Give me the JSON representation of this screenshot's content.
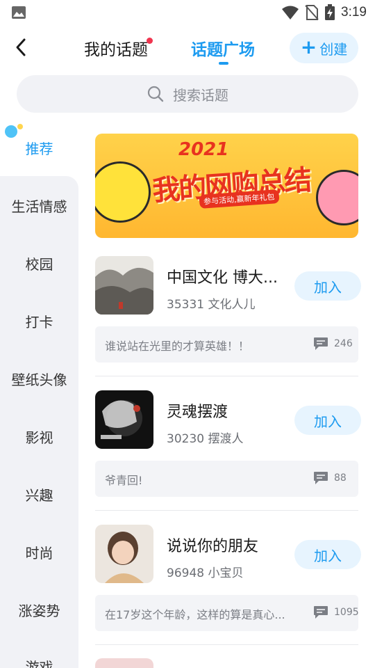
{
  "status_bar": {
    "time": "3:19"
  },
  "header": {
    "tab_mine": "我的话题",
    "tab_plaza": "话题广场",
    "create_label": "创建"
  },
  "search": {
    "placeholder": "搜索话题"
  },
  "sidebar": {
    "items": [
      {
        "label": "推荐"
      },
      {
        "label": "生活情感"
      },
      {
        "label": "校园"
      },
      {
        "label": "打卡"
      },
      {
        "label": "壁纸头像"
      },
      {
        "label": "影视"
      },
      {
        "label": "兴趣"
      },
      {
        "label": "时尚"
      },
      {
        "label": "涨姿势"
      },
      {
        "label": "游戏"
      }
    ]
  },
  "banner": {
    "year": "2021",
    "title": "我的网购总结",
    "subtitle": "参与活动,赢新年礼包"
  },
  "topics": [
    {
      "name": "中国文化 博大...",
      "meta": "35331 文化人儿",
      "join_label": "加入",
      "quote": "谁说站在光里的才算英雄！！",
      "comment_count": "246"
    },
    {
      "name": "灵魂摆渡",
      "meta": "30230 摆渡人",
      "join_label": "加入",
      "quote": "爷青回!",
      "comment_count": "88"
    },
    {
      "name": "说说你的朋友",
      "meta": "96948 小宝贝",
      "join_label": "加入",
      "quote": "在17岁这个年龄，这样的算是真心...",
      "comment_count": "1095"
    }
  ],
  "colors": {
    "accent": "#1d9bf0",
    "badge": "#f0354f",
    "sidebar_bg": "#f1f2f6"
  }
}
